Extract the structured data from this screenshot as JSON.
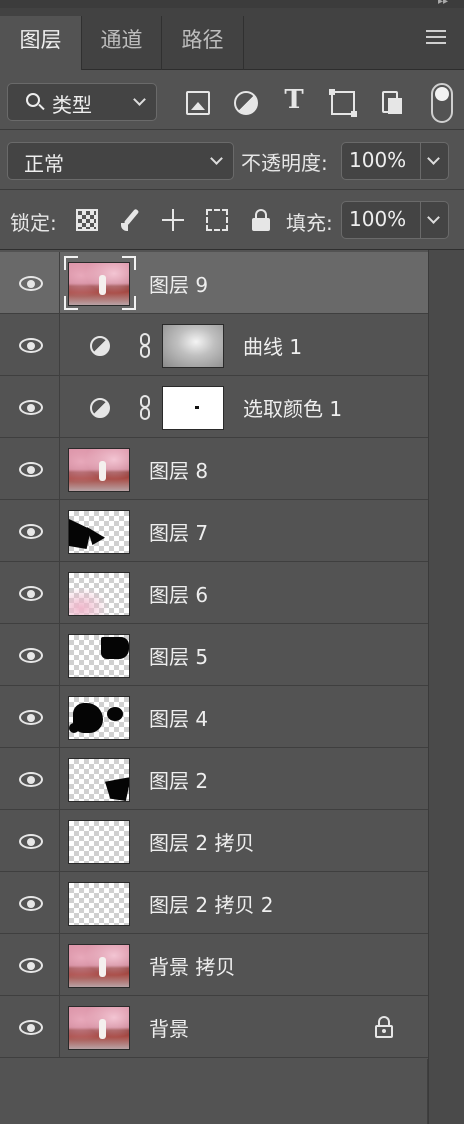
{
  "panel": {
    "tabs": [
      {
        "label": "图层",
        "active": true
      },
      {
        "label": "通道",
        "active": false
      },
      {
        "label": "路径",
        "active": false
      }
    ],
    "menu_icon": "hamburger-menu-icon"
  },
  "filter": {
    "kind_label": "类型",
    "icons": [
      "image-filter-icon",
      "adjustment-filter-icon",
      "type-filter-icon",
      "shape-filter-icon",
      "smart-object-filter-icon"
    ],
    "toggle_on": true
  },
  "blend": {
    "mode": "正常",
    "opacity_label": "不透明度:",
    "opacity_value": "100%"
  },
  "lock": {
    "label": "锁定:",
    "fill_label": "填充:",
    "fill_value": "100%"
  },
  "layers": [
    {
      "name": "图层 9",
      "thumb": "photo",
      "selected": true,
      "visible": true
    },
    {
      "name": "曲线 1",
      "thumb": "gray",
      "type": "adjustment",
      "visible": true
    },
    {
      "name": "选取颜色 1",
      "thumb": "mask",
      "type": "adjustment",
      "visible": true
    },
    {
      "name": "图层 8",
      "thumb": "photo",
      "visible": true
    },
    {
      "name": "图层 7",
      "thumb": "checker",
      "visible": true
    },
    {
      "name": "图层 6",
      "thumb": "checker",
      "visible": true
    },
    {
      "name": "图层 5",
      "thumb": "checker",
      "visible": true
    },
    {
      "name": "图层 4",
      "thumb": "checker",
      "visible": true
    },
    {
      "name": "图层 2",
      "thumb": "checker",
      "visible": true
    },
    {
      "name": "图层 2 拷贝",
      "thumb": "checker",
      "visible": true
    },
    {
      "name": "图层 2 拷贝 2",
      "thumb": "checker",
      "visible": true
    },
    {
      "name": "背景 拷贝",
      "thumb": "photo",
      "visible": true
    },
    {
      "name": "背景",
      "thumb": "photo",
      "visible": true,
      "locked": true
    }
  ]
}
